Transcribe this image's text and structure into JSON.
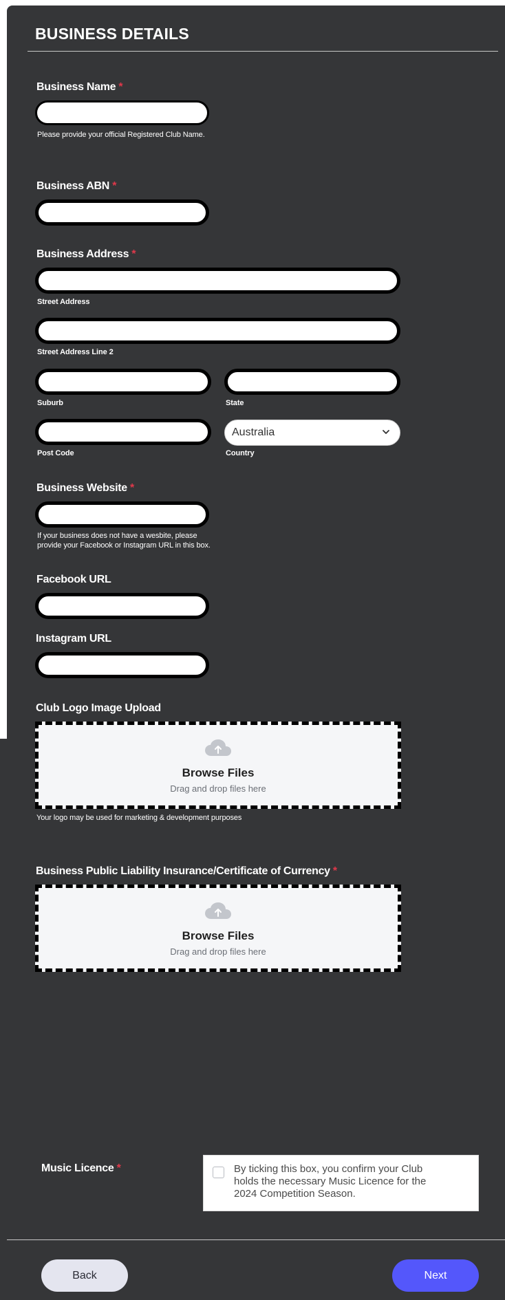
{
  "section": {
    "title": "BUSINESS DETAILS"
  },
  "required_marker": "*",
  "fields": {
    "business_name": {
      "label": "Business Name",
      "value": "",
      "help": "Please provide your official Registered Club Name."
    },
    "business_abn": {
      "label": "Business ABN",
      "value": ""
    },
    "business_address": {
      "label": "Business Address",
      "street": {
        "value": "",
        "sublabel": "Street Address"
      },
      "street2": {
        "value": "",
        "sublabel": "Street Address Line 2"
      },
      "suburb": {
        "value": "",
        "sublabel": "Suburb"
      },
      "state": {
        "value": "",
        "sublabel": "State"
      },
      "postcode": {
        "value": "",
        "sublabel": "Post Code"
      },
      "country": {
        "value": "Australia",
        "sublabel": "Country"
      }
    },
    "business_website": {
      "label": "Business Website",
      "value": "",
      "help_line1": "If your business does not have a wesbite, please",
      "help_line2": "provide your Facebook or Instagram URL in this box."
    },
    "facebook_url": {
      "label": "Facebook URL",
      "value": ""
    },
    "instagram_url": {
      "label": "Instagram URL",
      "value": ""
    },
    "club_logo": {
      "label": "Club Logo Image Upload",
      "browse": "Browse Files",
      "drag": "Drag and drop files here",
      "help": "Your logo may be used for marketing & development purposes"
    },
    "insurance": {
      "label": "Business Public Liability Insurance/Certificate of Currency",
      "browse": "Browse Files",
      "drag": "Drag and drop files here"
    },
    "music_licence": {
      "label": "Music Licence",
      "checked": false,
      "line1": "By ticking this box, you confirm your Club",
      "line2": "holds the necessary Music Licence for the",
      "line3": "2024 Competition Season."
    }
  },
  "actions": {
    "back": "Back",
    "next": "Next"
  },
  "icons": {
    "upload": "cloud-upload-icon",
    "chevron": "chevron-down-icon"
  },
  "colors": {
    "panel": "#353638",
    "required": "#e0384a",
    "next_button": "#5457fb",
    "back_button": "#e4e5ef"
  }
}
